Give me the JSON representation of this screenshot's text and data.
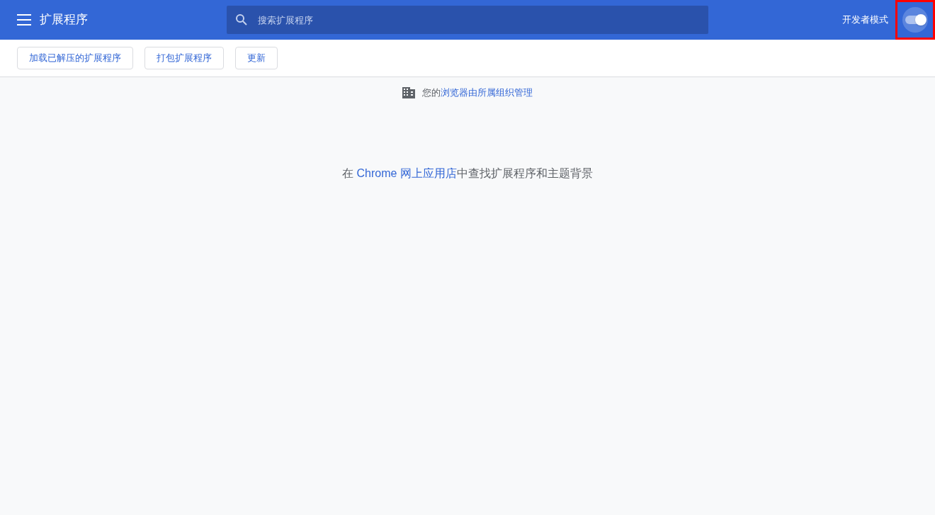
{
  "toolbar": {
    "title": "扩展程序",
    "search": {
      "placeholder": "搜索扩展程序"
    },
    "dev_mode": {
      "label": "开发者模式",
      "on": true,
      "highlighted": true
    }
  },
  "actions": [
    "加载已解压的扩展程序",
    "打包扩展程序",
    "更新"
  ],
  "managed_notice": {
    "before": "您的",
    "link": "浏览器由所属组织管理"
  },
  "store_line": {
    "before": "在 ",
    "link": "Chrome 网上应用店",
    "after": "中查找扩展程序和主题背景"
  }
}
